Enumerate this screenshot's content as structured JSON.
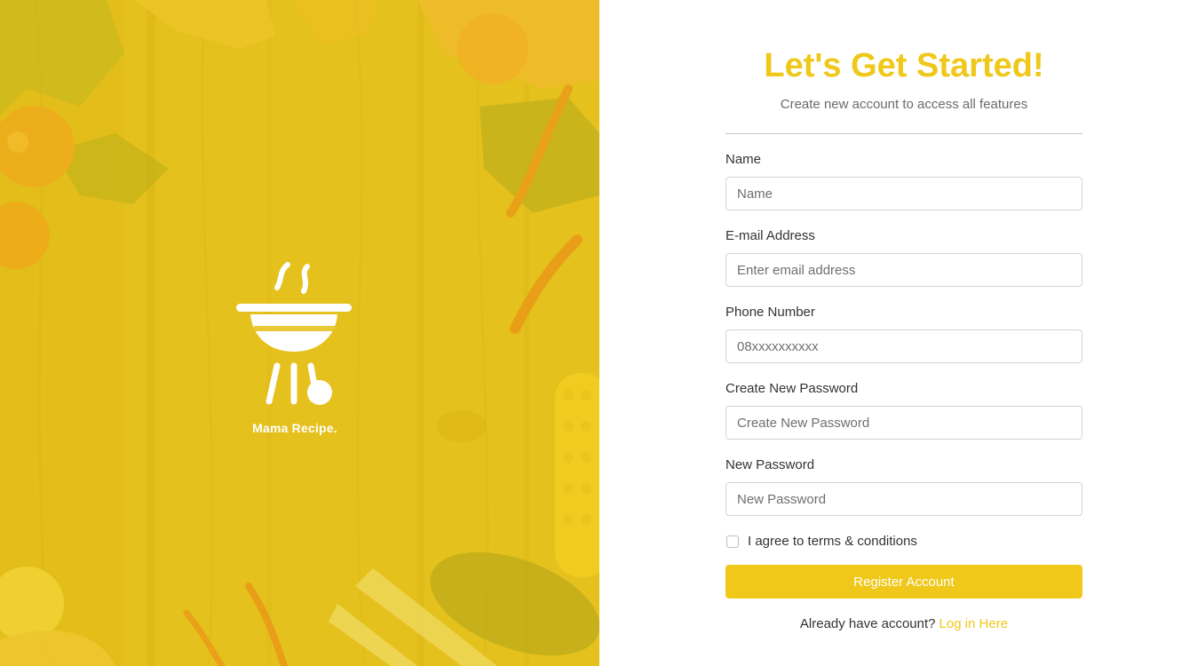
{
  "brand": {
    "name": "Mama Recipe.",
    "logo_icon": "grill-icon"
  },
  "colors": {
    "accent": "#efc81a",
    "hero_overlay": "#e5c21f"
  },
  "form": {
    "title": "Let's Get Started!",
    "subtitle": "Create new account to access all features",
    "fields": [
      {
        "label": "Name",
        "placeholder": "Name",
        "value": ""
      },
      {
        "label": "E-mail Address",
        "placeholder": "Enter email address",
        "value": ""
      },
      {
        "label": "Phone Number",
        "placeholder": "08xxxxxxxxxx",
        "value": ""
      },
      {
        "label": "Create New Password",
        "placeholder": "Create New Password",
        "value": ""
      },
      {
        "label": "New Password",
        "placeholder": "New Password",
        "value": ""
      }
    ],
    "agree_label": "I agree to terms & conditions",
    "agree_checked": false,
    "register_label": "Register Account",
    "login_prompt": "Already have account?",
    "login_link": "Log in Here"
  }
}
